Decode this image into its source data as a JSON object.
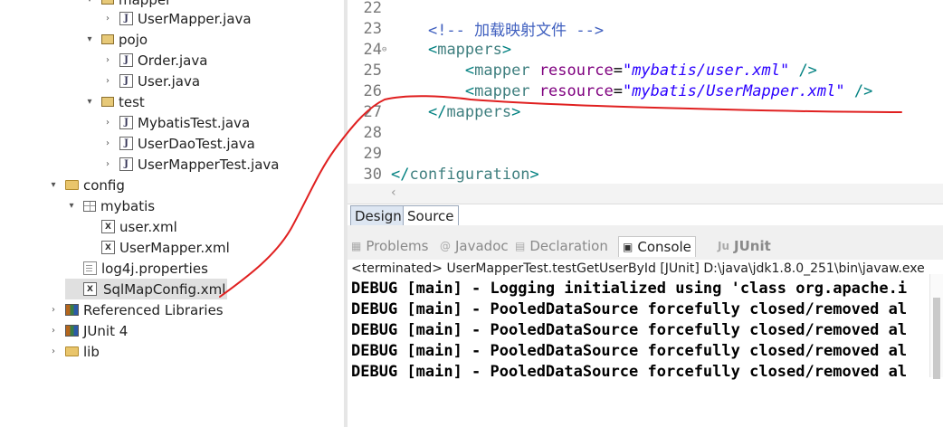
{
  "explorer": {
    "rows": [
      {
        "label": "mapper",
        "kind": "pkg",
        "tw": "▾"
      },
      {
        "label": "UserMapper.java",
        "kind": "java",
        "tw": "›"
      },
      {
        "label": "pojo",
        "kind": "pkg",
        "tw": "▾"
      },
      {
        "label": "Order.java",
        "kind": "java",
        "tw": "›"
      },
      {
        "label": "User.java",
        "kind": "java",
        "tw": "›"
      },
      {
        "label": "test",
        "kind": "pkg",
        "tw": "▾"
      },
      {
        "label": "MybatisTest.java",
        "kind": "java",
        "tw": "›"
      },
      {
        "label": "UserDaoTest.java",
        "kind": "java",
        "tw": "›"
      },
      {
        "label": "UserMapperTest.java",
        "kind": "java",
        "tw": "›"
      },
      {
        "label": "config",
        "kind": "folder",
        "tw": "▾"
      },
      {
        "label": "mybatis",
        "kind": "pkg2",
        "tw": "▾"
      },
      {
        "label": "user.xml",
        "kind": "xml",
        "tw": ""
      },
      {
        "label": "UserMapper.xml",
        "kind": "xml",
        "tw": ""
      },
      {
        "label": "log4j.properties",
        "kind": "file",
        "tw": ""
      },
      {
        "label": "SqlMapConfig.xml",
        "kind": "xml",
        "tw": "",
        "selected": true
      },
      {
        "label": "Referenced Libraries",
        "kind": "lib",
        "tw": "›"
      },
      {
        "label": "JUnit 4",
        "kind": "lib",
        "tw": "›"
      },
      {
        "label": "lib",
        "kind": "folder",
        "tw": "›"
      }
    ]
  },
  "editor": {
    "lines": [
      {
        "num": "22",
        "fold": "",
        "html": ""
      },
      {
        "num": "23",
        "fold": "",
        "html": "    <span class=\"cmt\">&lt;!-- 加载映射文件 --&gt;</span>"
      },
      {
        "num": "24",
        "fold": "⊖",
        "html": "    <span class=\"bracket\">&lt;</span><span class=\"tag\">mappers</span><span class=\"bracket\">&gt;</span>"
      },
      {
        "num": "25",
        "fold": "",
        "html": "        <span class=\"bracket\">&lt;</span><span class=\"tag\">mapper</span> <span class=\"attr\">resource</span>=<span class=\"val\">\"mybatis/user.xml\"</span> <span class=\"bracket\">/&gt;</span>"
      },
      {
        "num": "26",
        "fold": "",
        "html": "        <span class=\"bracket\">&lt;</span><span class=\"tag\">mapper</span> <span class=\"attr\">resource</span>=<span class=\"val\">\"mybatis/UserMapper.xml\"</span> <span class=\"bracket\">/&gt;</span>"
      },
      {
        "num": "27",
        "fold": "",
        "html": "    <span class=\"bracket\">&lt;/</span><span class=\"tag\">mappers</span><span class=\"bracket\">&gt;</span>"
      },
      {
        "num": "28",
        "fold": "",
        "html": ""
      },
      {
        "num": "29",
        "fold": "",
        "html": ""
      },
      {
        "num": "30",
        "fold": "",
        "html": "<span class=\"bracket\">&lt;/</span><span class=\"tag\">configuration</span><span class=\"bracket\">&gt;</span>"
      }
    ],
    "tabs": {
      "design": "Design",
      "source": "Source"
    }
  },
  "views": {
    "tabs": [
      {
        "label": "Problems",
        "icon": "problems-icon",
        "glyph": "▦"
      },
      {
        "label": "Javadoc",
        "icon": "javadoc-icon",
        "glyph": "@"
      },
      {
        "label": "Declaration",
        "icon": "declaration-icon",
        "glyph": "▤"
      },
      {
        "label": "Console",
        "icon": "console-icon",
        "glyph": "▣",
        "active": true
      },
      {
        "label": "JUnit",
        "icon": "junit-icon",
        "glyph": "Ju"
      }
    ]
  },
  "console": {
    "status": "<terminated> UserMapperTest.testGetUserById [JUnit] D:\\java\\jdk1.8.0_251\\bin\\javaw.exe",
    "lines": [
      "DEBUG [main] - Logging initialized using 'class org.apache.i",
      "DEBUG [main] - PooledDataSource forcefully closed/removed al",
      "DEBUG [main] - PooledDataSource forcefully closed/removed al",
      "DEBUG [main] - PooledDataSource forcefully closed/removed al",
      "DEBUG [main] - PooledDataSource forcefully closed/removed al"
    ]
  },
  "annotation_color": "#e02020"
}
